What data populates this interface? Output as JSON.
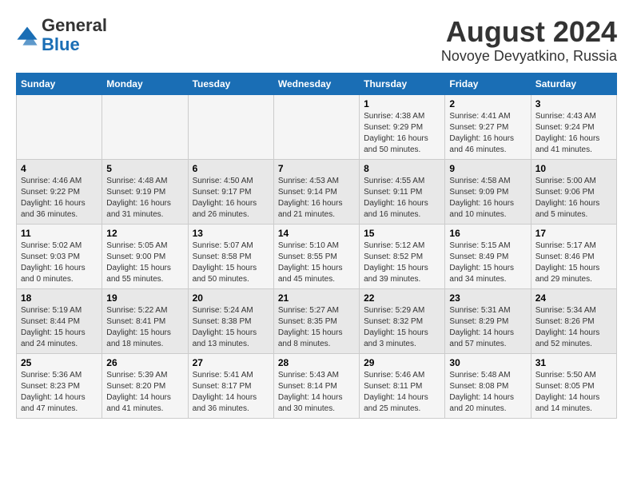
{
  "header": {
    "logo_line1": "General",
    "logo_line2": "Blue",
    "month_year": "August 2024",
    "location": "Novoye Devyatkino, Russia"
  },
  "weekdays": [
    "Sunday",
    "Monday",
    "Tuesday",
    "Wednesday",
    "Thursday",
    "Friday",
    "Saturday"
  ],
  "weeks": [
    [
      {
        "day": "",
        "info": ""
      },
      {
        "day": "",
        "info": ""
      },
      {
        "day": "",
        "info": ""
      },
      {
        "day": "",
        "info": ""
      },
      {
        "day": "1",
        "info": "Sunrise: 4:38 AM\nSunset: 9:29 PM\nDaylight: 16 hours\nand 50 minutes."
      },
      {
        "day": "2",
        "info": "Sunrise: 4:41 AM\nSunset: 9:27 PM\nDaylight: 16 hours\nand 46 minutes."
      },
      {
        "day": "3",
        "info": "Sunrise: 4:43 AM\nSunset: 9:24 PM\nDaylight: 16 hours\nand 41 minutes."
      }
    ],
    [
      {
        "day": "4",
        "info": "Sunrise: 4:46 AM\nSunset: 9:22 PM\nDaylight: 16 hours\nand 36 minutes."
      },
      {
        "day": "5",
        "info": "Sunrise: 4:48 AM\nSunset: 9:19 PM\nDaylight: 16 hours\nand 31 minutes."
      },
      {
        "day": "6",
        "info": "Sunrise: 4:50 AM\nSunset: 9:17 PM\nDaylight: 16 hours\nand 26 minutes."
      },
      {
        "day": "7",
        "info": "Sunrise: 4:53 AM\nSunset: 9:14 PM\nDaylight: 16 hours\nand 21 minutes."
      },
      {
        "day": "8",
        "info": "Sunrise: 4:55 AM\nSunset: 9:11 PM\nDaylight: 16 hours\nand 16 minutes."
      },
      {
        "day": "9",
        "info": "Sunrise: 4:58 AM\nSunset: 9:09 PM\nDaylight: 16 hours\nand 10 minutes."
      },
      {
        "day": "10",
        "info": "Sunrise: 5:00 AM\nSunset: 9:06 PM\nDaylight: 16 hours\nand 5 minutes."
      }
    ],
    [
      {
        "day": "11",
        "info": "Sunrise: 5:02 AM\nSunset: 9:03 PM\nDaylight: 16 hours\nand 0 minutes."
      },
      {
        "day": "12",
        "info": "Sunrise: 5:05 AM\nSunset: 9:00 PM\nDaylight: 15 hours\nand 55 minutes."
      },
      {
        "day": "13",
        "info": "Sunrise: 5:07 AM\nSunset: 8:58 PM\nDaylight: 15 hours\nand 50 minutes."
      },
      {
        "day": "14",
        "info": "Sunrise: 5:10 AM\nSunset: 8:55 PM\nDaylight: 15 hours\nand 45 minutes."
      },
      {
        "day": "15",
        "info": "Sunrise: 5:12 AM\nSunset: 8:52 PM\nDaylight: 15 hours\nand 39 minutes."
      },
      {
        "day": "16",
        "info": "Sunrise: 5:15 AM\nSunset: 8:49 PM\nDaylight: 15 hours\nand 34 minutes."
      },
      {
        "day": "17",
        "info": "Sunrise: 5:17 AM\nSunset: 8:46 PM\nDaylight: 15 hours\nand 29 minutes."
      }
    ],
    [
      {
        "day": "18",
        "info": "Sunrise: 5:19 AM\nSunset: 8:44 PM\nDaylight: 15 hours\nand 24 minutes."
      },
      {
        "day": "19",
        "info": "Sunrise: 5:22 AM\nSunset: 8:41 PM\nDaylight: 15 hours\nand 18 minutes."
      },
      {
        "day": "20",
        "info": "Sunrise: 5:24 AM\nSunset: 8:38 PM\nDaylight: 15 hours\nand 13 minutes."
      },
      {
        "day": "21",
        "info": "Sunrise: 5:27 AM\nSunset: 8:35 PM\nDaylight: 15 hours\nand 8 minutes."
      },
      {
        "day": "22",
        "info": "Sunrise: 5:29 AM\nSunset: 8:32 PM\nDaylight: 15 hours\nand 3 minutes."
      },
      {
        "day": "23",
        "info": "Sunrise: 5:31 AM\nSunset: 8:29 PM\nDaylight: 14 hours\nand 57 minutes."
      },
      {
        "day": "24",
        "info": "Sunrise: 5:34 AM\nSunset: 8:26 PM\nDaylight: 14 hours\nand 52 minutes."
      }
    ],
    [
      {
        "day": "25",
        "info": "Sunrise: 5:36 AM\nSunset: 8:23 PM\nDaylight: 14 hours\nand 47 minutes."
      },
      {
        "day": "26",
        "info": "Sunrise: 5:39 AM\nSunset: 8:20 PM\nDaylight: 14 hours\nand 41 minutes."
      },
      {
        "day": "27",
        "info": "Sunrise: 5:41 AM\nSunset: 8:17 PM\nDaylight: 14 hours\nand 36 minutes."
      },
      {
        "day": "28",
        "info": "Sunrise: 5:43 AM\nSunset: 8:14 PM\nDaylight: 14 hours\nand 30 minutes."
      },
      {
        "day": "29",
        "info": "Sunrise: 5:46 AM\nSunset: 8:11 PM\nDaylight: 14 hours\nand 25 minutes."
      },
      {
        "day": "30",
        "info": "Sunrise: 5:48 AM\nSunset: 8:08 PM\nDaylight: 14 hours\nand 20 minutes."
      },
      {
        "day": "31",
        "info": "Sunrise: 5:50 AM\nSunset: 8:05 PM\nDaylight: 14 hours\nand 14 minutes."
      }
    ]
  ]
}
